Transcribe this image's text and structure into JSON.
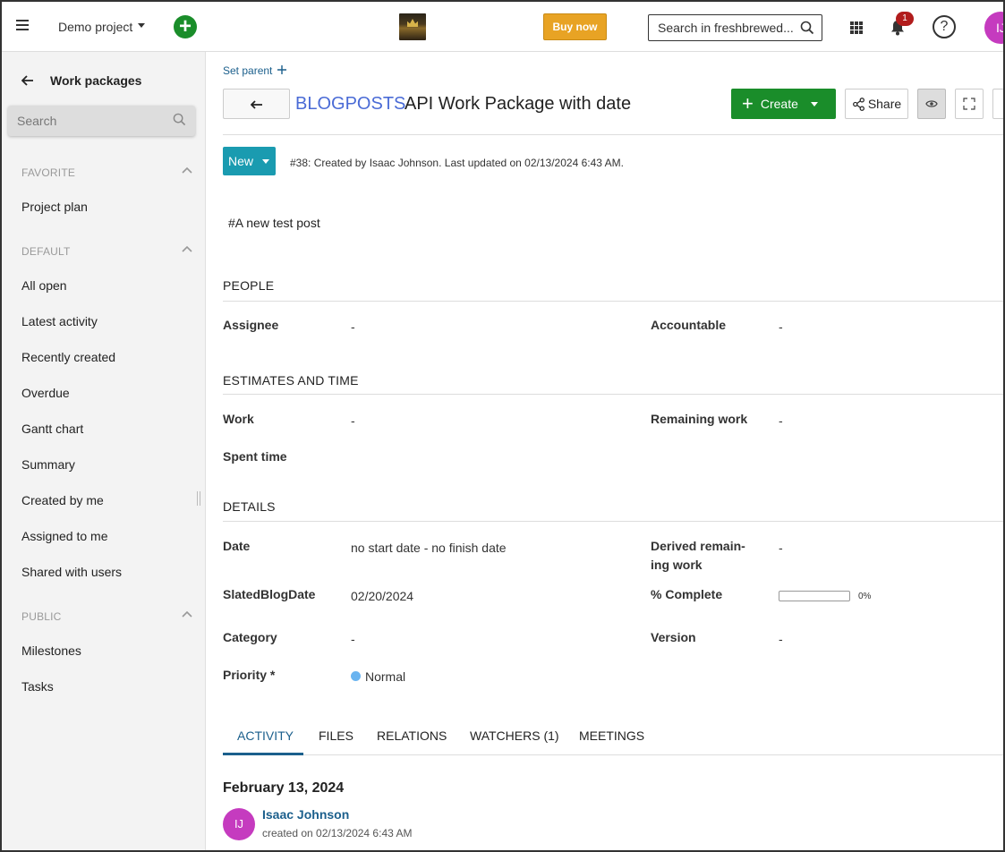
{
  "header": {
    "project": "Demo project",
    "buy_now": "Buy now",
    "search_placeholder": "Search in freshbrewed...",
    "notification_count": "1",
    "help": "?",
    "user_initials": "IJ"
  },
  "sidebar": {
    "back_title": "Work packages",
    "search_placeholder": "Search",
    "sections": [
      {
        "title": "FAVORITE",
        "items": [
          "Project plan"
        ]
      },
      {
        "title": "DEFAULT",
        "items": [
          "All open",
          "Latest activity",
          "Recently created",
          "Overdue",
          "Gantt chart",
          "Summary",
          "Created by me",
          "Assigned to me",
          "Shared with users"
        ]
      },
      {
        "title": "PUBLIC",
        "items": [
          "Milestones",
          "Tasks"
        ]
      }
    ]
  },
  "work_package": {
    "set_parent": "Set parent",
    "type": "BLOGPOSTS",
    "subject": "API Work Package with date",
    "create_label": "Create",
    "share_label": "Share",
    "status": "New",
    "meta": "#38: Created by Isaac Johnson. Last updated on 02/13/2024 6:43 AM.",
    "description": "#A new test post",
    "sections": {
      "people": "PEOPLE",
      "estimates": "ESTIMATES AND TIME",
      "details": "DETAILS"
    },
    "fields": {
      "assignee_label": "Assignee",
      "assignee_value": "-",
      "accountable_label": "Accountable",
      "accountable_value": "-",
      "work_label": "Work",
      "work_value": "-",
      "remaining_label": "Remaining work",
      "remaining_value": "-",
      "spent_label": "Spent time",
      "date_label": "Date",
      "date_value": "no start date - no finish date",
      "derived_label_1": "Derived remain-",
      "derived_label_2": "ing work",
      "derived_value": "-",
      "slated_label": "SlatedBlogDate",
      "slated_value": "02/20/2024",
      "complete_label": "% Complete",
      "complete_value": "0%",
      "complete_fraction": 0,
      "category_label": "Category",
      "category_value": "-",
      "version_label": "Version",
      "version_value": "-",
      "priority_label": "Priority *",
      "priority_value": "Normal"
    },
    "tabs": [
      "ACTIVITY",
      "FILES",
      "RELATIONS",
      "WATCHERS (1)",
      "MEETINGS"
    ],
    "activity": {
      "date": "February 13, 2024",
      "user_initials": "IJ",
      "user": "Isaac Johnson",
      "text": "created on 02/13/2024 6:43 AM"
    }
  },
  "colors": {
    "accent_green": "#1a8d2a",
    "status_teal": "#1a9bb0",
    "link_blue": "#1b5f8c",
    "type_blue": "#4a6bd6",
    "buy_orange": "#e8a324",
    "avatar_magenta": "#c53bbf",
    "priority_normal": "#6ab4f0"
  }
}
